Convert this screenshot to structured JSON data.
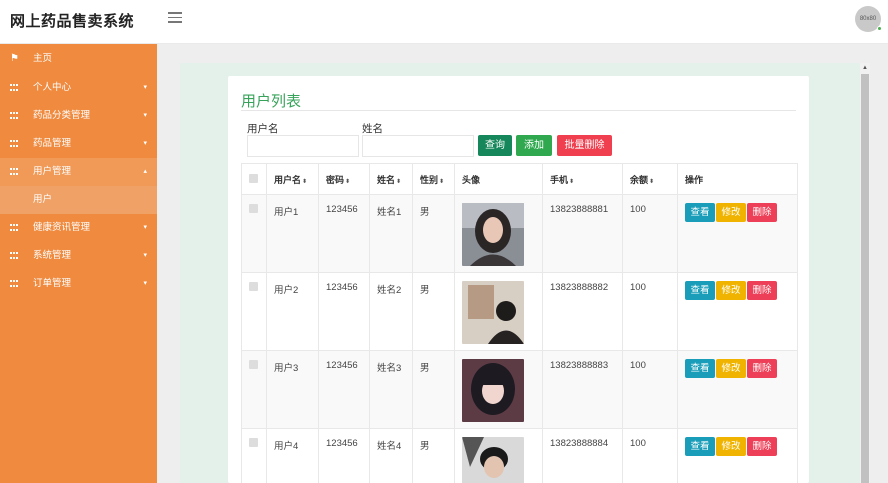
{
  "header": {
    "app_title": "网上药品售卖系统",
    "avatar_text": "80x80"
  },
  "sidebar": {
    "items": [
      {
        "label": "主页",
        "icon": "flag-icon"
      },
      {
        "label": "个人中心",
        "icon": "grid-icon",
        "caret": "▾"
      },
      {
        "label": "药品分类管理",
        "icon": "grid-icon",
        "caret": "▾"
      },
      {
        "label": "药品管理",
        "icon": "grid-icon",
        "caret": "▾"
      },
      {
        "label": "用户管理",
        "icon": "grid-icon",
        "caret": "▴",
        "expanded": true
      },
      {
        "label": "健康资讯管理",
        "icon": "grid-icon",
        "caret": "▾"
      },
      {
        "label": "系统管理",
        "icon": "grid-icon",
        "caret": "▾"
      },
      {
        "label": "订单管理",
        "icon": "grid-icon",
        "caret": "▾"
      }
    ],
    "sub_item": "用户"
  },
  "card": {
    "title": "用户列表"
  },
  "search": {
    "username_label": "用户名",
    "username_value": "",
    "name_label": "姓名",
    "name_value": "",
    "search_btn": "查询",
    "add_btn": "添加",
    "batch_delete_btn": "批量删除"
  },
  "table": {
    "sort_glyph": "⬍",
    "columns": [
      "用户名",
      "密码",
      "姓名",
      "性别",
      "头像",
      "手机",
      "余额",
      "操作"
    ],
    "rows": [
      {
        "username": "用户1",
        "password": "123456",
        "name": "姓名1",
        "gender": "男",
        "phone": "13823888881",
        "balance": "100"
      },
      {
        "username": "用户2",
        "password": "123456",
        "name": "姓名2",
        "gender": "男",
        "phone": "13823888882",
        "balance": "100"
      },
      {
        "username": "用户3",
        "password": "123456",
        "name": "姓名3",
        "gender": "男",
        "phone": "13823888883",
        "balance": "100"
      },
      {
        "username": "用户4",
        "password": "123456",
        "name": "姓名4",
        "gender": "男",
        "phone": "13823888884",
        "balance": "100"
      }
    ],
    "actions": {
      "view": "查看",
      "edit": "修改",
      "delete": "删除"
    }
  },
  "colors": {
    "sidebar": "#ef8a3e",
    "title_green": "#37a35a",
    "search_btn": "#15875a",
    "add_btn": "#2fa84f",
    "delete_btn": "#f0404f",
    "view_btn": "#1a9db8",
    "edit_btn": "#f0b400"
  }
}
